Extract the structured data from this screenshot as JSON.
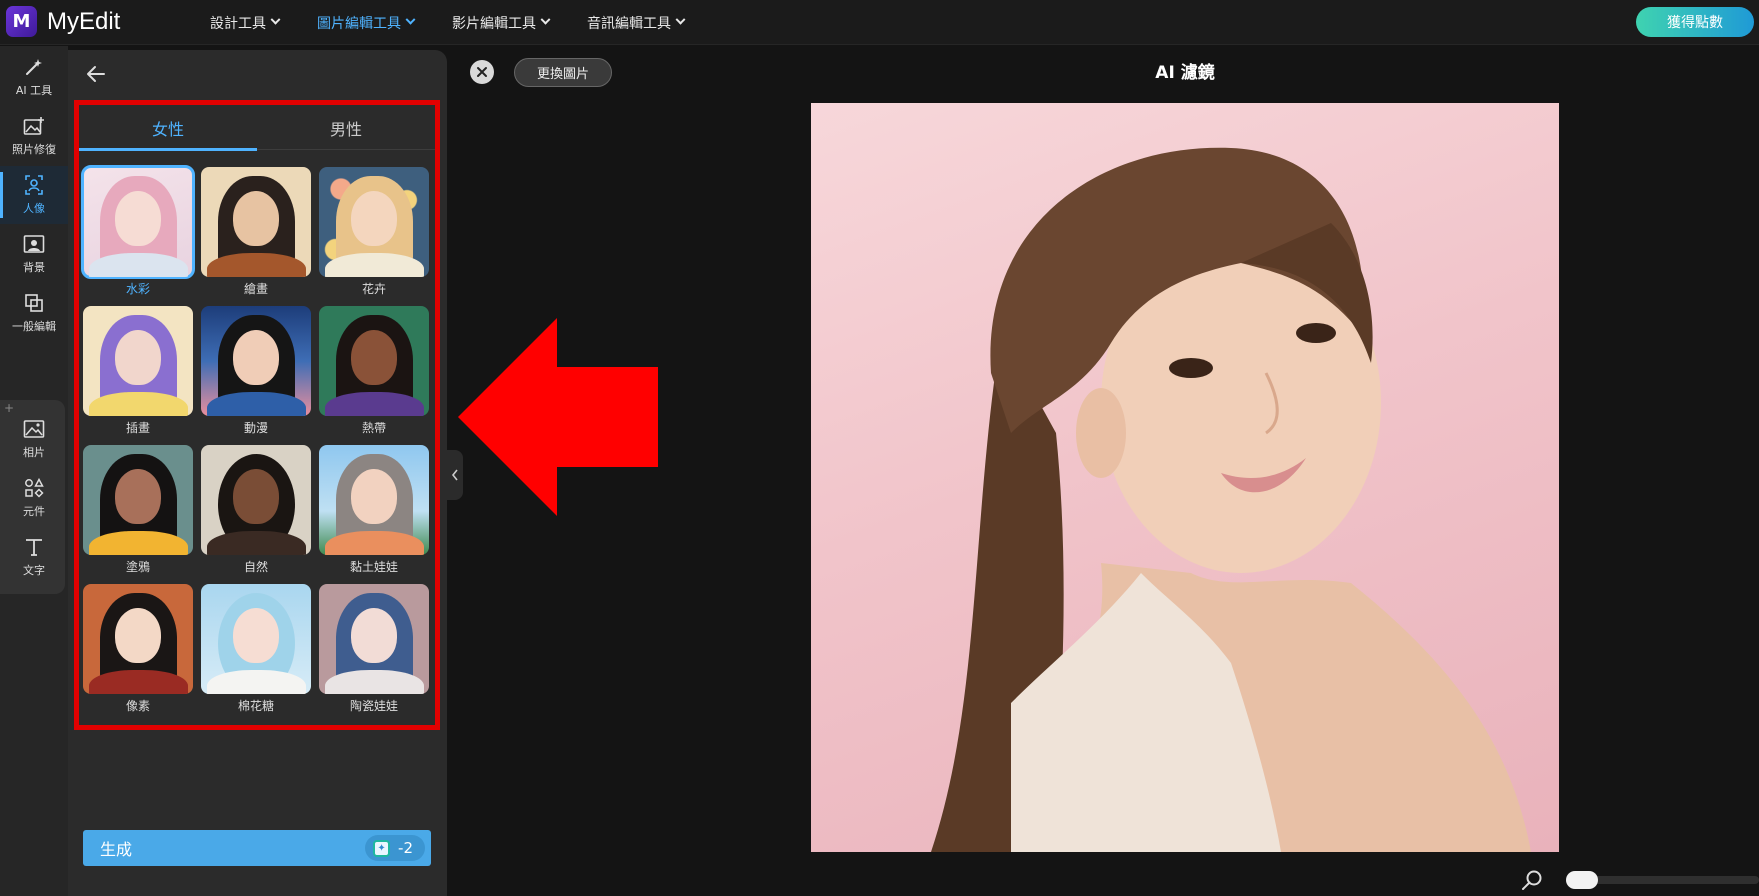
{
  "app": {
    "name": "MyEdit",
    "logo_letter": "M"
  },
  "nav": {
    "items": [
      {
        "label": "設計工具",
        "active": false
      },
      {
        "label": "圖片編輯工具",
        "active": true
      },
      {
        "label": "影片編輯工具",
        "active": false
      },
      {
        "label": "音訊編輯工具",
        "active": false
      }
    ],
    "cta_label": "獲得點數"
  },
  "rail": {
    "items": [
      {
        "label": "AI 工具",
        "icon": "magic-wand-icon"
      },
      {
        "label": "照片修復",
        "icon": "photo-fix-icon"
      },
      {
        "label": "人像",
        "icon": "portrait-icon",
        "active": true
      },
      {
        "label": "背景",
        "icon": "background-icon"
      },
      {
        "label": "一般編輯",
        "icon": "crop-icon"
      },
      {
        "label": "相片",
        "icon": "image-icon"
      },
      {
        "label": "元件",
        "icon": "shapes-icon"
      },
      {
        "label": "文字",
        "icon": "text-icon"
      }
    ]
  },
  "panel": {
    "tabs": [
      {
        "label": "女性",
        "active": true
      },
      {
        "label": "男性",
        "active": false
      }
    ],
    "styles": [
      {
        "label": "水彩",
        "selected": true
      },
      {
        "label": "繪畫"
      },
      {
        "label": "花卉"
      },
      {
        "label": "插畫"
      },
      {
        "label": "動漫"
      },
      {
        "label": "熱帶"
      },
      {
        "label": "塗鴉"
      },
      {
        "label": "自然"
      },
      {
        "label": "黏土娃娃"
      },
      {
        "label": "像素"
      },
      {
        "label": "棉花糖"
      },
      {
        "label": "陶瓷娃娃"
      }
    ],
    "generate_label": "生成",
    "credit_cost": "-2"
  },
  "canvas": {
    "replace_label": "更換圖片",
    "title": "AI 濾鏡"
  },
  "colors": {
    "accent": "#4fb3ff",
    "highlight_red": "#e10000",
    "generate_bg": "#4aa9e8"
  }
}
